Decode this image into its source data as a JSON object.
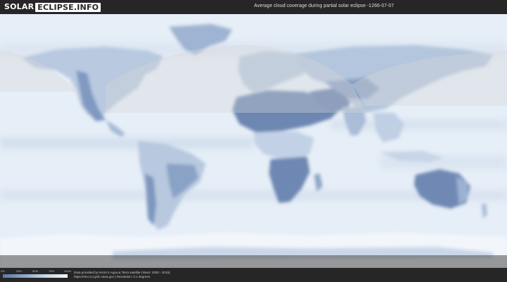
{
  "header": {
    "logo_part1": "SOLAR",
    "logo_part2": "ECLIPSE.INFO",
    "title": "Average cloud coverage during partial solar eclipse -1266-07-07"
  },
  "legend": {
    "ticks": [
      "0%",
      "25%",
      "50%",
      "75%",
      "100%"
    ],
    "colors": [
      "#5b78a6",
      "#8ea6c8",
      "#c8d6e8",
      "#f2f6fb"
    ]
  },
  "credits": {
    "line1": "Data provided by NASA's Aqua & Terra satellite (Years: 2000 - 2019)",
    "line2": "https://neo.sci.gsfc.nasa.gov | Resolution: 0.1 degrees"
  },
  "colors": {
    "background": "#262626",
    "ocean_cloud": "#e4ecf5",
    "land_clear": "#6a85b0",
    "eclipse_overlay": "#d9d9d9"
  }
}
